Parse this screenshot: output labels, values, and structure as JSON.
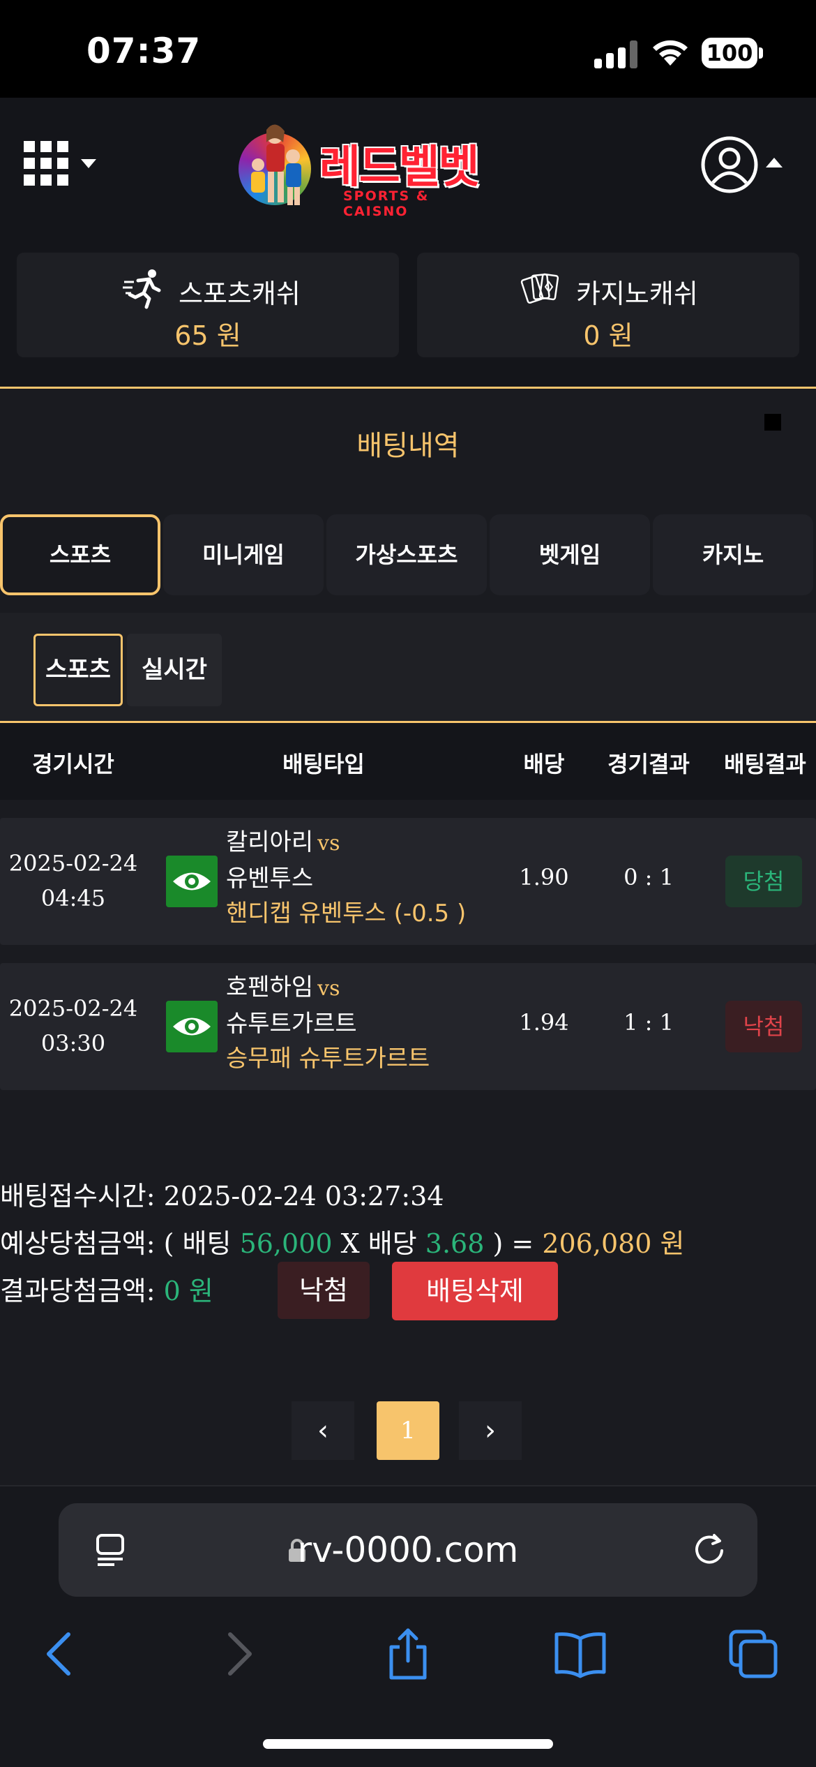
{
  "status_bar": {
    "time": "07:37",
    "battery": "100"
  },
  "header": {
    "logo_text": "레드벨벳",
    "logo_sub": "SPORTS & CAISNO"
  },
  "cash": {
    "sports": {
      "label": "스포츠캐쉬",
      "value": "65 원"
    },
    "casino": {
      "label": "카지노캐쉬",
      "value": "0 원"
    }
  },
  "page_title": "배팅내역",
  "tabs": [
    {
      "label": "스포츠",
      "active": true
    },
    {
      "label": "미니게임"
    },
    {
      "label": "가상스포츠"
    },
    {
      "label": "벳게임"
    },
    {
      "label": "카지노"
    }
  ],
  "subtabs": [
    {
      "label": "스포츠",
      "active": true
    },
    {
      "label": "실시간"
    }
  ],
  "table": {
    "headers": [
      "경기시간",
      "배팅타입",
      "배당",
      "경기결과",
      "배팅결과"
    ],
    "rows": [
      {
        "date": "2025-02-24",
        "time": "04:45",
        "home": "칼리아리",
        "vs": "vs",
        "away": "유벤투스",
        "pick": "핸디캡 유벤투스 (-0.5 )",
        "odds": "1.90",
        "score": "0 : 1",
        "result": "당첨"
      },
      {
        "date": "2025-02-24",
        "time": "03:30",
        "home": "호펜하임",
        "vs": "vs",
        "away": "슈투트가르트",
        "pick": "승무패 슈투트가르트",
        "odds": "1.94",
        "score": "1 : 1",
        "result": "낙첨"
      }
    ]
  },
  "summary": {
    "received_label": "배팅접수시간:",
    "received_value": "2025-02-24 03:27:34",
    "expected_label": "예상당첨금액: ( 배팅",
    "bet_amount": "56,000",
    "x_label": "X 배당",
    "total_odds": "3.68",
    "equals": ") =",
    "expected_win": "206,080 원",
    "result_label": "결과당첨금액:",
    "result_value": "0 원",
    "lose_button": "낙첨",
    "delete_button": "배팅삭제"
  },
  "pagination": {
    "prev": "‹",
    "current": "1",
    "next": "›"
  },
  "browser": {
    "url": "rv-0000.com"
  },
  "colors": {
    "accent": "#f7c46c",
    "win": "#2bb57a",
    "lose": "#e0434a",
    "delete": "#e03a3e"
  }
}
